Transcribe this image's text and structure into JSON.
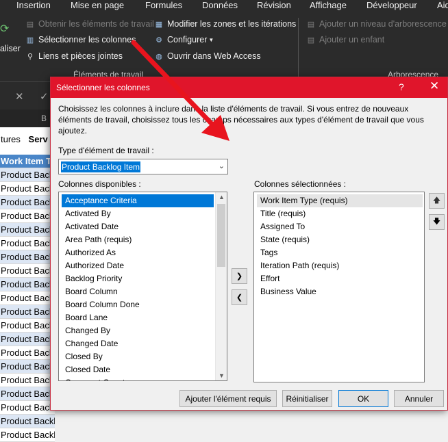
{
  "menu": [
    "Insertion",
    "Mise en page",
    "Formules",
    "Données",
    "Révision",
    "Affichage",
    "Développeur",
    "Aid"
  ],
  "ribbon": {
    "actualiser": "aliser",
    "obtenir": "Obtenir les éléments de travail",
    "select_cols": "Sélectionner les colonnes",
    "liens": "Liens et pièces jointes",
    "modifier_zones": "Modifier les zones et les itérations",
    "configurer": "Configurer",
    "ouvrir_web": "Ouvrir dans Web Access",
    "ajouter_niveau": "Ajouter un niveau d'arborescence",
    "ajouter_enfant": "Ajouter un enfant",
    "group_elements": "Éléments de travail",
    "group_arbo": "Arborescence"
  },
  "formula_bar": {
    "cancel": "✕",
    "confirm": "✓"
  },
  "sheet": {
    "col_letter": "B",
    "header_cells": [
      "tures",
      "Serv"
    ],
    "table_header": "Work Item Type",
    "rows": [
      "Product Backlog Item",
      "Product Backlog Item",
      "Product Backlog Item",
      "Product Backlog Item",
      "Product Backlog Item",
      "Product Backlog Item",
      "Product Backlog Item",
      "Product Backlog Item",
      "Product Backlog Item",
      "Product Backlog Item",
      "Product Backlog Item",
      "Product Backlog Item",
      "Product Backlog Item",
      "Product Backlog Item",
      "Product Backlog Item",
      "Product Backlog Item",
      "Product Backlog Item",
      "Product Backlog Item",
      "Product Backlog Item",
      "Product Backlog Item"
    ]
  },
  "dialog": {
    "title": "Sélectionner les colonnes",
    "help": "?",
    "close": "✕",
    "intro": "Choisissez les colonnes à inclure dans la liste d'éléments de travail.  Si vous entrez de nouveaux éléments de travail, choisissez tous les champs nécessaires aux types d'élément de travail que vous ajoutez.",
    "type_label": "Type d'élément de travail :",
    "type_value": "Product Backlog Item",
    "available_label": "Colonnes disponibles :",
    "available": [
      "Acceptance Criteria",
      "Activated By",
      "Activated Date",
      "Area Path (requis)",
      "Authorized As",
      "Authorized Date",
      "Backlog Priority",
      "Board Column",
      "Board Column Done",
      "Board Lane",
      "Changed By",
      "Changed Date",
      "Closed By",
      "Closed Date",
      "Comment Count"
    ],
    "selected_label": "Colonnes sélectionnées :",
    "selected": [
      "Work Item Type (requis)",
      "Title (requis)",
      "Assigned To",
      "State (requis)",
      "Tags",
      "Iteration Path (requis)",
      "Effort",
      "Business Value"
    ],
    "buttons": {
      "add_required": "Ajouter l'élément requis",
      "reset": "Réinitialiser",
      "ok": "OK",
      "cancel": "Annuler"
    }
  },
  "colors": {
    "accent": "#e0152b",
    "selection": "#0078d7",
    "annotation_arrow": "#e8141e"
  }
}
